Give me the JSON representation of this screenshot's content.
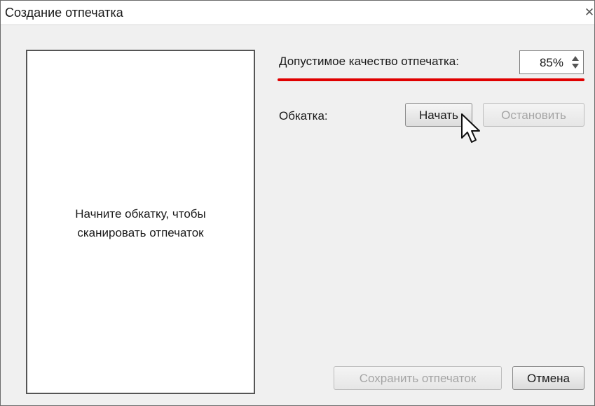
{
  "window": {
    "title": "Создание отпечатка",
    "close_glyph": "✕"
  },
  "preview": {
    "line1": "Начните обкатку, чтобы",
    "line2": "сканировать отпечаток"
  },
  "quality": {
    "label": "Допустимое качество отпечатка:",
    "value": "85%"
  },
  "rolling": {
    "label": "Обкатка:",
    "start_label": "Начать",
    "stop_label": "Остановить"
  },
  "footer": {
    "save_label": "Сохранить отпечаток",
    "cancel_label": "Отмена"
  },
  "colors": {
    "highlight_line": "#e00000",
    "disabled_text": "#a5a5a5"
  },
  "icons": {
    "spin_arrows": "up-down-arrows-icon",
    "cursor": "mouse-pointer-icon",
    "close": "close-icon"
  }
}
